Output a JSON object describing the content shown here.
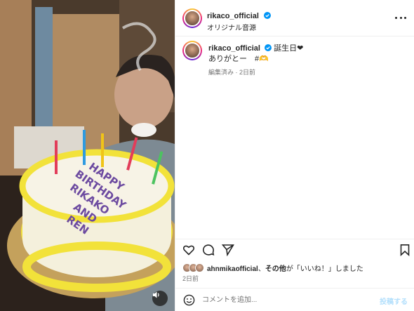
{
  "post": {
    "username": "rikaco_official",
    "audio_label": "オリジナル音源",
    "caption_lead": "誕生日❤",
    "caption_line2": "ありがとー　#🫶",
    "caption_meta": "編集済み · 2日前",
    "likes_user": "ahnmikaofficial",
    "likes_sep": "、",
    "likes_others": "その他",
    "likes_suffix": "が「いいね！」しました",
    "date": "2日前"
  },
  "cake_text": [
    "HAPPY",
    "BIRTHDAY",
    "RIKAKO",
    "AND",
    "REN"
  ],
  "comment": {
    "placeholder": "コメントを追加...",
    "post_label": "投稿する"
  },
  "icons": {
    "verified": "verified-badge-icon",
    "more": "more-options-icon",
    "like": "heart-icon",
    "comment": "comment-icon",
    "share": "share-icon",
    "save": "bookmark-icon",
    "emoji": "emoji-icon",
    "audio": "speaker-icon"
  },
  "colors": {
    "verified": "#0095f6",
    "post_disabled": "#b2dffc",
    "cake_frosting": "#f2e23a",
    "cake_text": "#6c4aa0"
  }
}
